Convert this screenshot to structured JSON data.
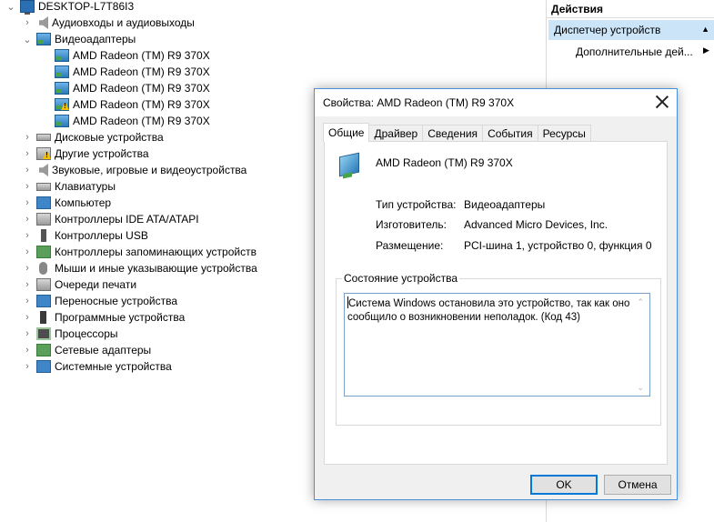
{
  "tree": {
    "root": "DESKTOP-L7T86I3",
    "items": [
      {
        "label": "Аудиовходы и аудиовыходы",
        "icon": "speaker-icon",
        "expanded": false
      },
      {
        "label": "Видеоадаптеры",
        "icon": "display-adapter-icon",
        "expanded": true
      },
      {
        "label": "AMD Radeon (TM) R9 370X",
        "icon": "display-adapter-icon",
        "child": true
      },
      {
        "label": "AMD Radeon (TM) R9 370X",
        "icon": "display-adapter-icon",
        "child": true
      },
      {
        "label": "AMD Radeon (TM) R9 370X",
        "icon": "display-adapter-icon",
        "child": true
      },
      {
        "label": "AMD Radeon (TM) R9 370X",
        "icon": "display-adapter-warning-icon",
        "child": true
      },
      {
        "label": "AMD Radeon (TM) R9 370X",
        "icon": "display-adapter-icon",
        "child": true
      },
      {
        "label": "Дисковые устройства",
        "icon": "disk-drive-icon",
        "expanded": false
      },
      {
        "label": "Другие устройства",
        "icon": "unknown-device-icon",
        "expanded": false
      },
      {
        "label": "Звуковые, игровые и видеоустройства",
        "icon": "sound-device-icon",
        "expanded": false
      },
      {
        "label": "Клавиатуры",
        "icon": "keyboard-icon",
        "expanded": false
      },
      {
        "label": "Компьютер",
        "icon": "computer-icon",
        "expanded": false
      },
      {
        "label": "Контроллеры IDE ATA/ATAPI",
        "icon": "ide-controller-icon",
        "expanded": false
      },
      {
        "label": "Контроллеры USB",
        "icon": "usb-icon",
        "expanded": false
      },
      {
        "label": "Контроллеры запоминающих устройств",
        "icon": "storage-controller-icon",
        "expanded": false
      },
      {
        "label": "Мыши и иные указывающие устройства",
        "icon": "mouse-icon",
        "expanded": false
      },
      {
        "label": "Очереди печати",
        "icon": "printer-icon",
        "expanded": false
      },
      {
        "label": "Переносные устройства",
        "icon": "portable-device-icon",
        "expanded": false
      },
      {
        "label": "Программные устройства",
        "icon": "software-device-icon",
        "expanded": false
      },
      {
        "label": "Процессоры",
        "icon": "processor-icon",
        "expanded": false
      },
      {
        "label": "Сетевые адаптеры",
        "icon": "network-adapter-icon",
        "expanded": false
      },
      {
        "label": "Системные устройства",
        "icon": "system-device-icon",
        "expanded": false
      }
    ]
  },
  "actions": {
    "header": "Действия",
    "section": "Диспетчер устройств",
    "item": "Дополнительные дей..."
  },
  "dialog": {
    "title": "Свойства: AMD Radeon (TM) R9 370X",
    "tabs": [
      "Общие",
      "Драйвер",
      "Сведения",
      "События",
      "Ресурсы"
    ],
    "active_tab": "Общие",
    "device_name": "AMD Radeon (TM) R9 370X",
    "props": [
      {
        "label": "Тип устройства:",
        "value": "Видеоадаптеры"
      },
      {
        "label": "Изготовитель:",
        "value": "Advanced Micro Devices, Inc."
      },
      {
        "label": "Размещение:",
        "value": "PCI-шина 1, устройство 0, функция 0"
      }
    ],
    "status_group": "Состояние устройства",
    "status_text": "Система Windows остановила это устройство, так как оно сообщило о возникновении неполадок. (Код 43)",
    "ok": "OK",
    "cancel": "Отмена"
  },
  "colors": {
    "selection": "#cce4f7",
    "dialog_border": "#4a90d9",
    "primary_button_border": "#0078d7",
    "warning": "#f2c200"
  }
}
